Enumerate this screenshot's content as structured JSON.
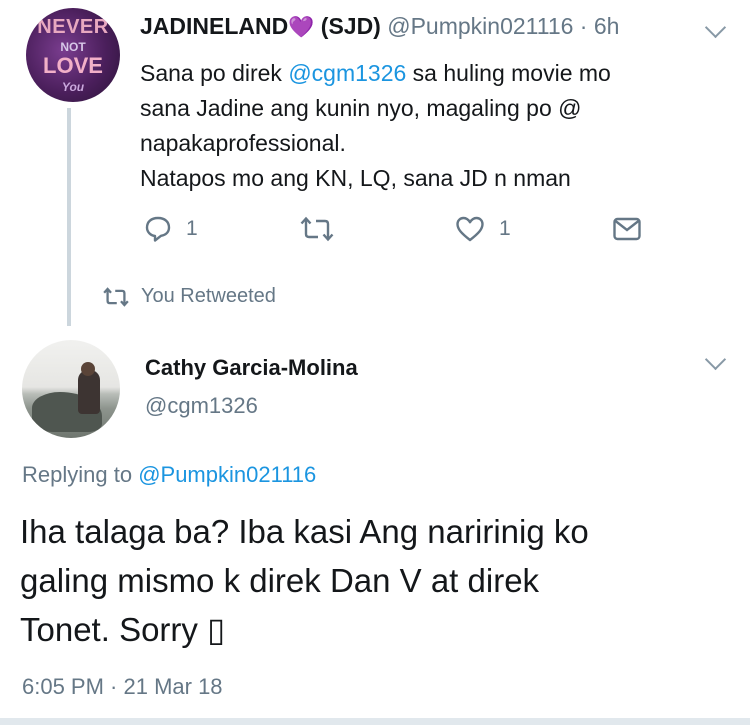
{
  "tweet1": {
    "display_name": "JADINELAND",
    "heart": "💜",
    "name_suffix": "(SJD)",
    "handle": "@Pumpkin021116",
    "time": "· 6h",
    "avatar_text": [
      "NEVER",
      "NOT",
      "LOVE",
      "You"
    ],
    "body": {
      "line1_pre": "Sana po direk ",
      "mention": "@cgm1326",
      "line1_post": " sa huling movie mo",
      "line2": "sana Jadine ang kunin nyo, magaling po @",
      "line3": "napakaprofessional.",
      "line4": "Natapos mo ang KN, LQ, sana JD n nman"
    },
    "actions": {
      "reply_count": "1",
      "like_count": "1"
    },
    "retweet_status": "You Retweeted"
  },
  "tweet2": {
    "display_name": "Cathy Garcia-Molina",
    "handle": "@cgm1326",
    "replying_label": "Replying to ",
    "replying_handle": "@Pumpkin021116",
    "body": {
      "line1": "Iha talaga ba? Iba kasi Ang naririnig ko",
      "line2": "galing mismo k direk Dan V at direk",
      "line3": "Tonet. Sorry ▯"
    },
    "timestamp": "6:05 PM · 21 Mar 18"
  },
  "colors": {
    "link": "#1b95e0",
    "muted": "#657786",
    "text": "#14171a",
    "heart": "#8a4bd1"
  }
}
